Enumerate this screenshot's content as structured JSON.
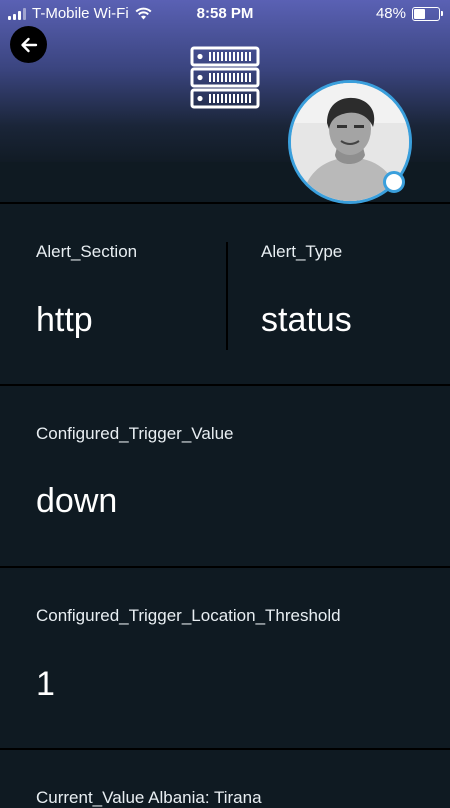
{
  "status_bar": {
    "carrier": "T-Mobile Wi-Fi",
    "time": "8:58 PM",
    "battery_percent": "48%",
    "battery_level": 0.48
  },
  "header": {
    "back_icon": "arrow-left-icon",
    "logo_icon": "server-rack-icon",
    "avatar_icon": "user-avatar",
    "accent_color": "#3a9fdc"
  },
  "cards": {
    "alert_section": {
      "label": "Alert_Section",
      "value": "http"
    },
    "alert_type": {
      "label": "Alert_Type",
      "value": "status"
    },
    "trigger_value": {
      "label": "Configured_Trigger_Value",
      "value": "down"
    },
    "location_threshold": {
      "label": "Configured_Trigger_Location_Threshold",
      "value": "1"
    },
    "current_value": {
      "label": "Current_Value Albania: Tirana"
    }
  }
}
